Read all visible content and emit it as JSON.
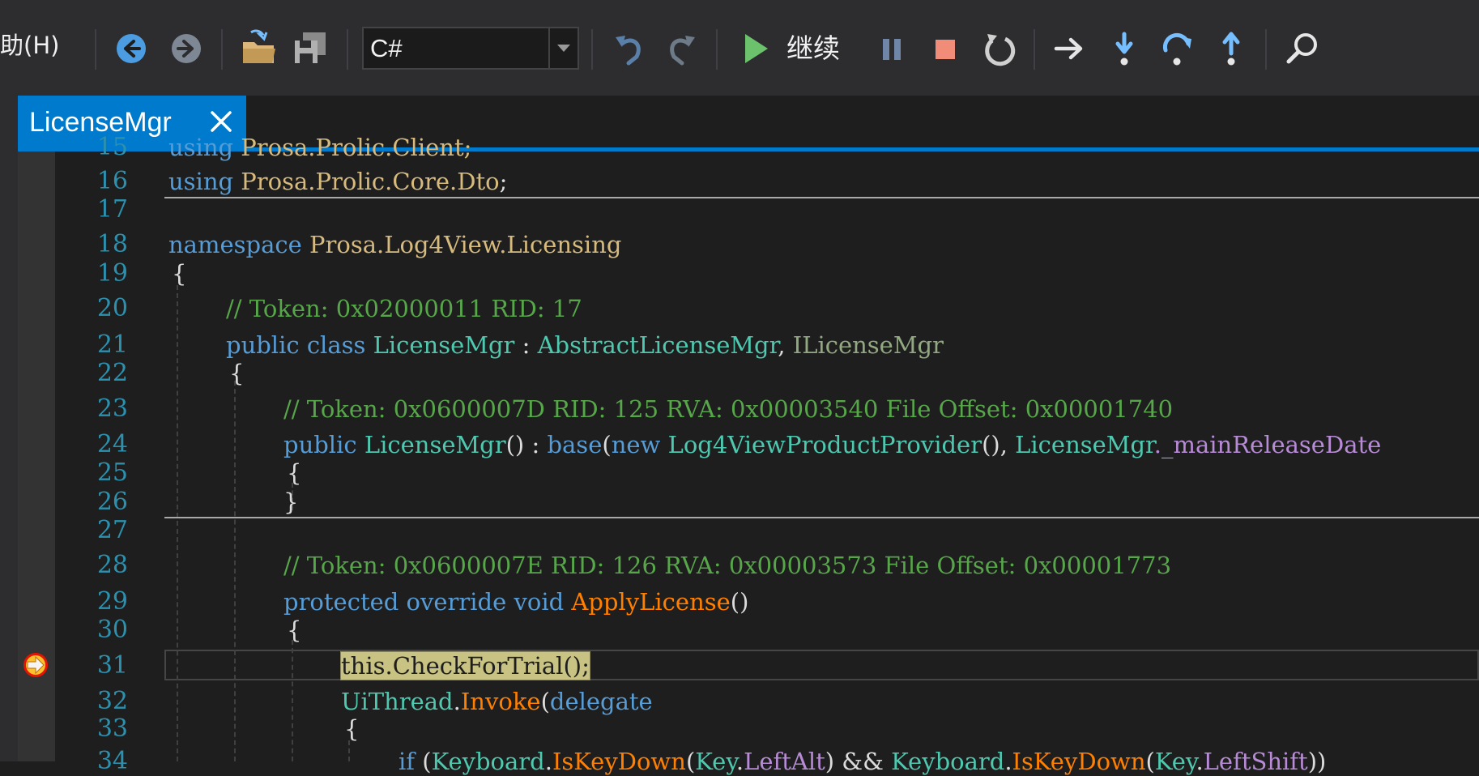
{
  "menu": {
    "help_label": "助(H)"
  },
  "toolbar": {
    "language_value": "C#",
    "continue_label": "继续",
    "icons": [
      "back-icon",
      "forward-icon",
      "open-folder-icon",
      "save-all-icon",
      "chevron-down-icon",
      "undo-icon",
      "redo-icon",
      "play-icon",
      "pause-icon",
      "stop-icon",
      "restart-icon",
      "show-next-statement-icon",
      "step-into-icon",
      "step-over-icon",
      "step-out-icon",
      "search-icon"
    ]
  },
  "tab": {
    "title": "LicenseMgr",
    "close_icon": "close-icon"
  },
  "editor": {
    "line_numbers": [
      "15",
      "16",
      "17",
      "18",
      "19",
      "20",
      "21",
      "22",
      "23",
      "24",
      "25",
      "26",
      "27",
      "28",
      "29",
      "30",
      "31",
      "32",
      "33",
      "34"
    ],
    "current_line": "31",
    "code": {
      "l15_a": "using",
      "l15_b": "Prosa.Prolic.Client;",
      "l16_a": "using",
      "l16_b": "Prosa.Prolic.Core.Dto",
      "l16_c": ";",
      "l18_a": "namespace",
      "l18_b": "Prosa.Log4View.Licensing",
      "l19": "{",
      "l20": "// Token: 0x02000011 RID: 17",
      "l21_a": "public class",
      "l21_b": "LicenseMgr",
      "l21_c": " : ",
      "l21_d": "AbstractLicenseMgr",
      "l21_e": ", ",
      "l21_f": "ILicenseMgr",
      "l22": "{",
      "l23": "// Token: 0x0600007D RID: 125 RVA: 0x00003540 File Offset: 0x00001740",
      "l24_a": "public",
      "l24_b": "LicenseMgr",
      "l24_c": "() : ",
      "l24_d": "base",
      "l24_e": "(",
      "l24_f": "new",
      "l24_g": "Log4ViewProductProvider",
      "l24_h": "(), ",
      "l24_i": "LicenseMgr",
      "l24_j": "._mainReleaseDate",
      "l25": "{",
      "l26": "}",
      "l28": "// Token: 0x0600007E RID: 126 RVA: 0x00003573 File Offset: 0x00001773",
      "l29_a": "protected override void",
      "l29_b": "ApplyLicense",
      "l29_c": "()",
      "l30": "{",
      "l31": "this.CheckForTrial();",
      "l32_a": "UiThread",
      "l32_b": ".",
      "l32_c": "Invoke",
      "l32_d": "(",
      "l32_e": "delegate",
      "l33": "{",
      "l34_a": "if",
      "l34_b": " (",
      "l34_c": "Keyboard",
      "l34_d": ".",
      "l34_e": "IsKeyDown",
      "l34_f": "(",
      "l34_g": "Key",
      "l34_h": ".",
      "l34_i": "LeftAlt",
      "l34_j": ") && ",
      "l34_k": "Keyboard",
      "l34_l": ".",
      "l34_m": "IsKeyDown",
      "l34_n": "(",
      "l34_o": "Key",
      "l34_p": ".",
      "l34_q": "LeftShift",
      "l34_r": "))"
    }
  }
}
